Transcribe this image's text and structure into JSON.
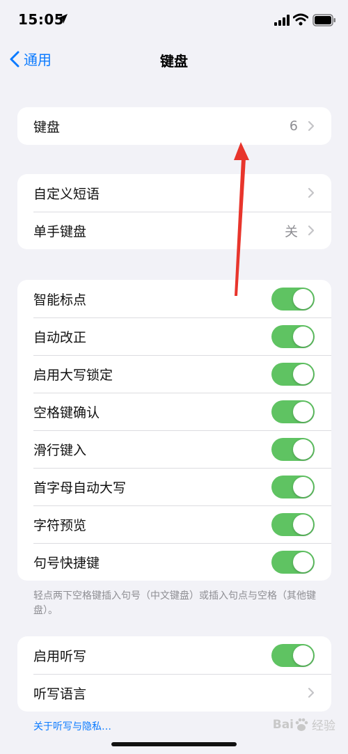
{
  "status_bar": {
    "time": "15:05"
  },
  "nav": {
    "back_label": "通用",
    "title": "键盘"
  },
  "group1": {
    "rows": [
      {
        "label": "键盘",
        "value": "6"
      }
    ]
  },
  "group2": {
    "rows": [
      {
        "label": "自定义短语",
        "value": ""
      },
      {
        "label": "单手键盘",
        "value": "关"
      }
    ]
  },
  "group3": {
    "rows": [
      {
        "label": "智能标点",
        "on": true
      },
      {
        "label": "自动改正",
        "on": true
      },
      {
        "label": "启用大写锁定",
        "on": true
      },
      {
        "label": "空格键确认",
        "on": true
      },
      {
        "label": "滑行键入",
        "on": true
      },
      {
        "label": "首字母自动大写",
        "on": true
      },
      {
        "label": "字符预览",
        "on": true
      },
      {
        "label": "句号快捷键",
        "on": true
      }
    ],
    "footnote": "轻点两下空格键插入句号（中文键盘）或插入句点与空格（其他键盘）。"
  },
  "group4": {
    "rows": [
      {
        "label": "启用听写",
        "on": true
      },
      {
        "label": "听写语言"
      }
    ],
    "link": "关于听写与隐私…"
  },
  "watermark": {
    "brand": "Bai",
    "sub": "经验"
  },
  "colors": {
    "accent": "#0a7aff",
    "toggle_on": "#5fc362",
    "background": "#f2f2f7",
    "annotation_arrow": "#e8352c"
  },
  "icons": [
    "location-arrow-icon",
    "cellular-signal-icon",
    "wifi-icon",
    "battery-icon",
    "chevron-left-icon",
    "chevron-right-icon",
    "baidu-paw-icon"
  ]
}
